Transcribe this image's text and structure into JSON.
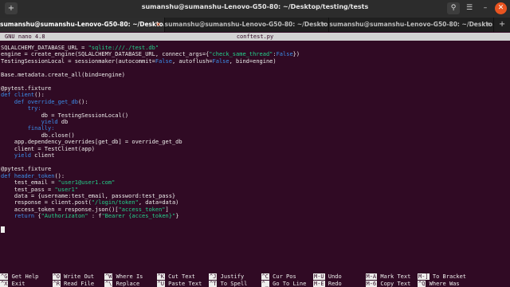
{
  "window": {
    "title": "sumanshu@sumanshu-Lenovo-G50-80: ~/Desktop/testing/tests",
    "new_tab_icon": "new-tab-icon",
    "search_icon": "search-icon",
    "menu_icon": "hamburger-menu-icon",
    "close_icon": "close-icon",
    "accent": "#e95420"
  },
  "tabs": [
    {
      "label": "sumanshu@sumanshu-Lenovo-G50-80: ~/Deskto..."
    },
    {
      "label": "sumanshu@sumanshu-Lenovo-G50-80: ~/Deskto..."
    },
    {
      "label": "sumanshu@sumanshu-Lenovo-G50-80: ~/Deskto..."
    }
  ],
  "nano": {
    "version": "GNU nano 4.8",
    "filename": "conftest.py"
  },
  "code_lines": [
    [
      {
        "t": "SQLALCHEMY_DATABASE_URL = "
      },
      {
        "t": "\"sqlite:///./test.db\"",
        "c": "str"
      }
    ],
    [
      {
        "t": "engine = create_engine(SQLALCHEMY_DATABASE_URL, connect_args={"
      },
      {
        "t": "\"check_same_thread\"",
        "c": "str"
      },
      {
        "t": ":"
      },
      {
        "t": "False",
        "c": "kw"
      },
      {
        "t": "})"
      }
    ],
    [
      {
        "t": "TestingSessionLocal = sessionmaker(autocommit="
      },
      {
        "t": "False",
        "c": "kw"
      },
      {
        "t": ", autoflush="
      },
      {
        "t": "False",
        "c": "kw"
      },
      {
        "t": ", bind=engine)"
      }
    ],
    [],
    [
      {
        "t": "Base.metadata.create_all(bind=engine)"
      }
    ],
    [],
    [
      {
        "t": "@pytest.fixture"
      }
    ],
    [
      {
        "t": "def ",
        "c": "kw"
      },
      {
        "t": "client",
        "c": "kw"
      },
      {
        "t": "():"
      }
    ],
    [
      {
        "t": "    "
      },
      {
        "t": "def ",
        "c": "kw"
      },
      {
        "t": "override_get_db",
        "c": "kw"
      },
      {
        "t": "():"
      }
    ],
    [
      {
        "t": "        "
      },
      {
        "t": "try:",
        "c": "kw"
      }
    ],
    [
      {
        "t": "            db = TestingSessionLocal()"
      }
    ],
    [
      {
        "t": "            "
      },
      {
        "t": "yield",
        "c": "kw"
      },
      {
        "t": " db"
      }
    ],
    [
      {
        "t": "        "
      },
      {
        "t": "finally:",
        "c": "kw"
      }
    ],
    [
      {
        "t": "            db.close()"
      }
    ],
    [
      {
        "t": "    app.dependency_overrides[get_db] = override_get_db"
      }
    ],
    [
      {
        "t": "    client = TestClient(app)"
      }
    ],
    [
      {
        "t": "    "
      },
      {
        "t": "yield",
        "c": "kw"
      },
      {
        "t": " client"
      }
    ],
    [],
    [
      {
        "t": "@pytest.fixture"
      }
    ],
    [
      {
        "t": "def ",
        "c": "kw"
      },
      {
        "t": "header_token",
        "c": "kw"
      },
      {
        "t": "():"
      }
    ],
    [
      {
        "t": "    test_email = "
      },
      {
        "t": "\"user1@user1.com\"",
        "c": "str"
      }
    ],
    [
      {
        "t": "    test_pass = "
      },
      {
        "t": "\"user1\"",
        "c": "str"
      }
    ],
    [
      {
        "t": "    data = {username:test_email, password:test_pass}"
      }
    ],
    [
      {
        "t": "    response = client.post("
      },
      {
        "t": "\"/login/token\"",
        "c": "str"
      },
      {
        "t": ", data=data)"
      }
    ],
    [
      {
        "t": "    access_token = response.json()["
      },
      {
        "t": "\"access_token\"",
        "c": "str"
      },
      {
        "t": "]"
      }
    ],
    [
      {
        "t": "    "
      },
      {
        "t": "return",
        "c": "kw"
      },
      {
        "t": " {"
      },
      {
        "t": "\"Authorizaton\"",
        "c": "str"
      },
      {
        "t": " : f"
      },
      {
        "t": "\"Bearer {acces_token}\"",
        "c": "str"
      },
      {
        "t": "}"
      }
    ],
    [],
    [
      {
        "cursor": true
      }
    ]
  ],
  "shortcuts": [
    [
      {
        "key": "^G",
        "label": "Get Help"
      },
      {
        "key": "^O",
        "label": "Write Out"
      },
      {
        "key": "^W",
        "label": "Where Is"
      },
      {
        "key": "^K",
        "label": "Cut Text"
      },
      {
        "key": "^J",
        "label": "Justify"
      },
      {
        "key": "^C",
        "label": "Cur Pos"
      },
      {
        "key": "M-U",
        "label": "Undo"
      },
      {
        "key": "M-A",
        "label": "Mark Text"
      },
      {
        "key": "M-]",
        "label": "To Bracket"
      }
    ],
    [
      {
        "key": "^X",
        "label": "Exit"
      },
      {
        "key": "^R",
        "label": "Read File"
      },
      {
        "key": "^\\",
        "label": "Replace"
      },
      {
        "key": "^U",
        "label": "Paste Text"
      },
      {
        "key": "^T",
        "label": "To Spell"
      },
      {
        "key": "^_",
        "label": "Go To Line"
      },
      {
        "key": "M-E",
        "label": "Redo"
      },
      {
        "key": "M-6",
        "label": "Copy Text"
      },
      {
        "key": "^Q",
        "label": "Where Was"
      }
    ]
  ]
}
